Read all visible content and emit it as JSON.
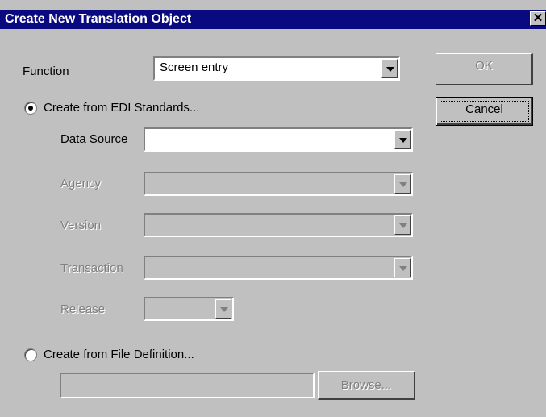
{
  "dialog": {
    "title": "Create New Translation Object",
    "close_glyph": "✕"
  },
  "function": {
    "label": "Function",
    "value": "Screen entry"
  },
  "edi": {
    "radio_label": "Create from EDI Standards...",
    "selected": true,
    "data_source_label": "Data Source",
    "data_source_value": "",
    "agency_label": "Agency",
    "version_label": "Version",
    "transaction_label": "Transaction",
    "release_label": "Release"
  },
  "file_def": {
    "radio_label": "Create from File Definition...",
    "selected": false,
    "path_value": "",
    "browse_label": "Browse..."
  },
  "buttons": {
    "ok": "OK",
    "cancel": "Cancel"
  }
}
